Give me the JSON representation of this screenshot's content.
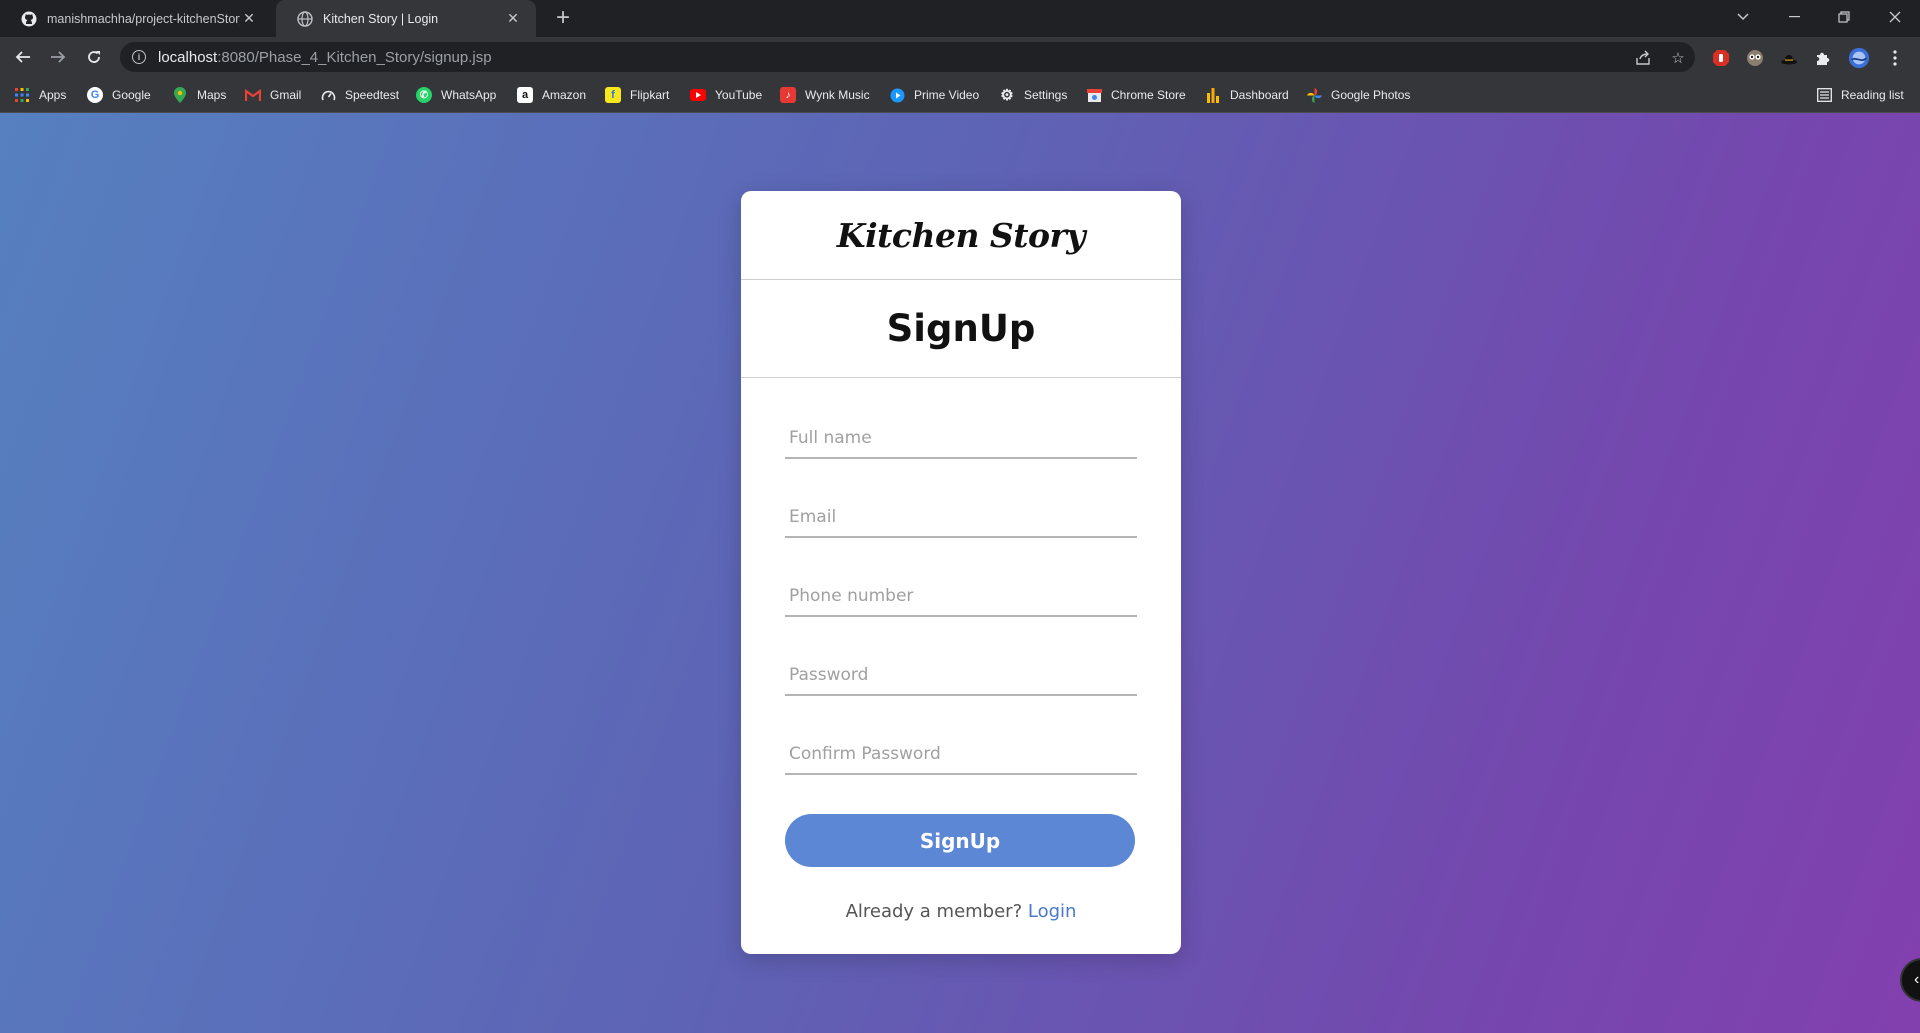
{
  "browser": {
    "tabs": [
      {
        "title": "manishmachha/project-kitchenStory",
        "icon": "github-icon",
        "active": false
      },
      {
        "title": "Kitchen Story | Login",
        "icon": "globe-icon",
        "active": true
      }
    ],
    "address": {
      "host": "localhost",
      "path": ":8080/Phase_4_Kitchen_Story/signup.jsp"
    },
    "bookmarks": [
      {
        "label": "Apps",
        "icon": "apps-grid-icon"
      },
      {
        "label": "Google",
        "icon": "google-icon"
      },
      {
        "label": "Maps",
        "icon": "maps-pin-icon"
      },
      {
        "label": "Gmail",
        "icon": "gmail-icon"
      },
      {
        "label": "Speedtest",
        "icon": "speedometer-icon"
      },
      {
        "label": "WhatsApp",
        "icon": "whatsapp-icon"
      },
      {
        "label": "Amazon",
        "icon": "amazon-icon"
      },
      {
        "label": "Flipkart",
        "icon": "flipkart-icon"
      },
      {
        "label": "YouTube",
        "icon": "youtube-icon"
      },
      {
        "label": "Wynk Music",
        "icon": "wynk-icon"
      },
      {
        "label": "Prime Video",
        "icon": "prime-video-icon"
      },
      {
        "label": "Settings",
        "icon": "gear-icon"
      },
      {
        "label": "Chrome Store",
        "icon": "chrome-store-icon"
      },
      {
        "label": "Dashboard",
        "icon": "dashboard-icon"
      },
      {
        "label": "Google Photos",
        "icon": "photos-pinwheel-icon"
      }
    ],
    "reading_list": "Reading list"
  },
  "page": {
    "brand": "Kitchen Story",
    "heading": "SignUp",
    "fields": [
      {
        "placeholder": "Full name"
      },
      {
        "placeholder": "Email"
      },
      {
        "placeholder": "Phone number"
      },
      {
        "placeholder": "Password"
      },
      {
        "placeholder": "Confirm Password"
      }
    ],
    "submit_label": "SignUp",
    "member_text": "Already a member?",
    "login_link": "Login"
  },
  "colors": {
    "gradient_start": "#5680c0",
    "gradient_end": "#8240ae",
    "button": "#5b87d4",
    "link": "#4a78cc"
  }
}
